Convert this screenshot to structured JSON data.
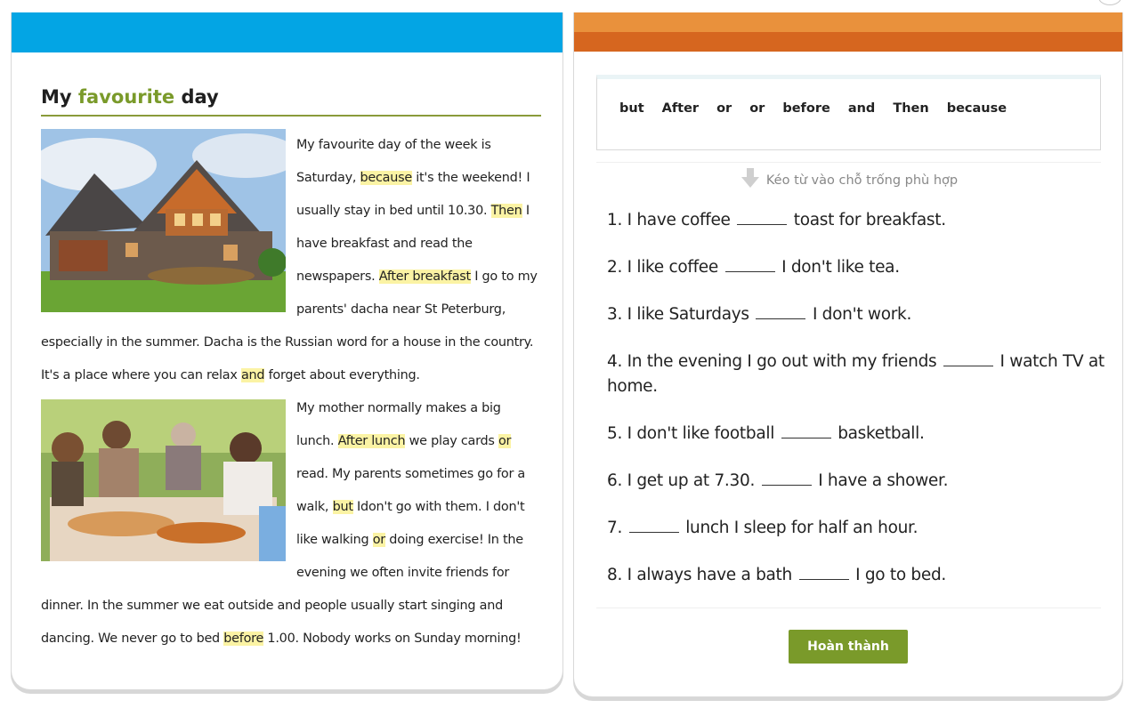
{
  "reading": {
    "title_pre": "My",
    "title_highlight": "favourite",
    "title_post": "day",
    "p1": [
      {
        "t": "My favourite day of the week is Saturday, "
      },
      {
        "t": "because",
        "hl": true
      },
      {
        "t": " it's the weekend! I usually stay in bed until 10.30. "
      },
      {
        "t": "Then",
        "hl": true
      },
      {
        "t": " I have breakfast and read the newspapers. "
      },
      {
        "t": "After breakfast",
        "hl": true
      },
      {
        "t": " I go to my parents' dacha near St Peterburg, especially in the summer. Dacha is the Russian word for a house in the country. It's a place where you can relax "
      },
      {
        "t": "and",
        "hl": true
      },
      {
        "t": " forget about everything."
      }
    ],
    "p2": [
      {
        "t": "My mother normally makes a big lunch. "
      },
      {
        "t": "After lunch",
        "hl": true
      },
      {
        "t": " we play cards "
      },
      {
        "t": "or",
        "hl": true
      },
      {
        "t": " read. My parents sometimes go for a walk, "
      },
      {
        "t": "but",
        "hl": true
      },
      {
        "t": " Idon't go with them. I don't like walking "
      },
      {
        "t": "or",
        "hl": true
      },
      {
        "t": " doing exercise! In the evening we often invite friends for dinner. In the summer we eat outside and people usually start singing and dancing. We never go to bed "
      },
      {
        "t": "before",
        "hl": true
      },
      {
        "t": " 1.00. Nobody works on Sunday morning!"
      }
    ]
  },
  "word_bank": [
    "but",
    "After",
    "or",
    "or",
    "before",
    "and",
    "Then",
    "because"
  ],
  "hint": "Kéo từ vào chỗ trống phù hợp",
  "questions": [
    {
      "pre": "1. I have coffee",
      "post": "toast for breakfast."
    },
    {
      "pre": "2. I like coffee",
      "post": "I don't like tea."
    },
    {
      "pre": "3. I like Saturdays",
      "post": "I don't work."
    },
    {
      "pre": "4. In the evening I go out with my friends",
      "post": "I watch TV at home."
    },
    {
      "pre": "5. I don't like football",
      "post": "basketball."
    },
    {
      "pre": "6. I get up at 7.30.",
      "post": "I have a shower."
    },
    {
      "pre": "7.",
      "post": "lunch I sleep for half an hour."
    },
    {
      "pre": "8. I always have a bath",
      "post": "I go to bed."
    }
  ],
  "done_button": "Hoàn thành",
  "colors": {
    "left_bar": "#03a5e4",
    "right_bar_top": "#e9913c",
    "right_bar_bottom": "#d6661f",
    "accent_green": "#7a9a2a",
    "highlight": "#fbf3a4"
  },
  "images": [
    {
      "name": "house-photo"
    },
    {
      "name": "family-lunch-photo"
    }
  ]
}
